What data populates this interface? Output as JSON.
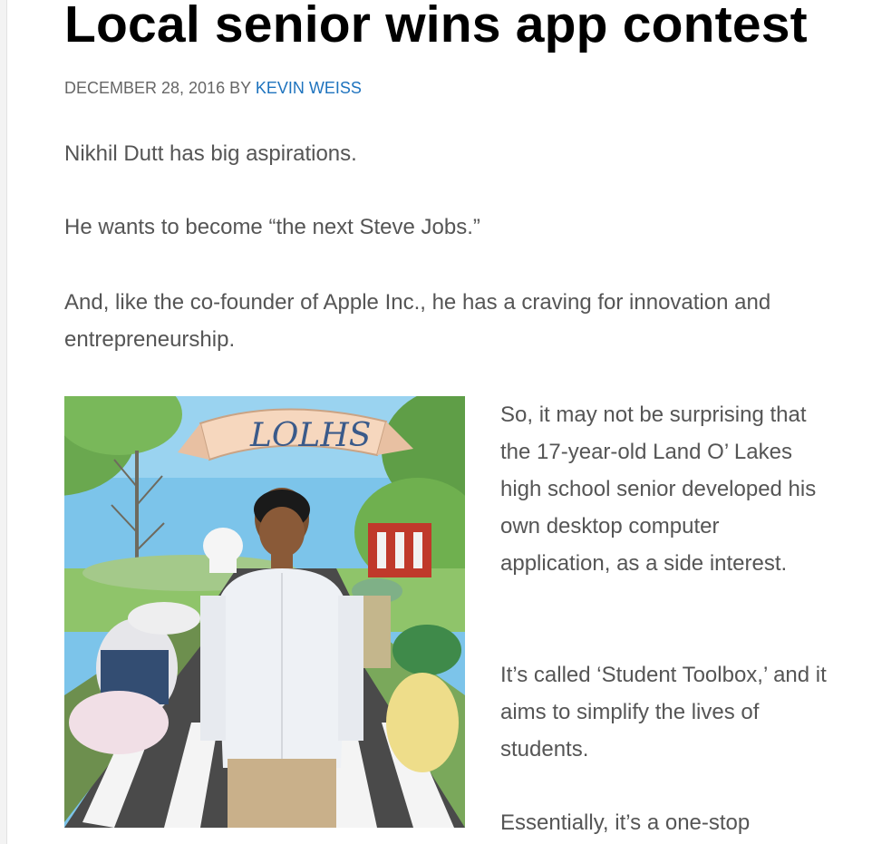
{
  "article": {
    "title": "Local senior wins app contest",
    "date": "DECEMBER 28, 2016",
    "by": "BY",
    "author": "KEVIN WEISS",
    "paragraphs": [
      "Nikhil Dutt has big aspirations.",
      "He wants to become “the next Steve Jobs.”",
      "And, like the co-founder of Apple Inc., he has a craving for innovation and entrepreneurship."
    ],
    "side_paragraphs": [
      "So, it may not be surprising that the 17-year-old Land O’ Lakes high school senior developed his own desktop computer application, as a side interest.",
      "It’s called ‘Student Toolbox,’ and it aims to simplify the lives of students.",
      "Essentially, it’s a one-stop"
    ],
    "photo": {
      "banner_text": "LOLHS",
      "icon": "photo-student-mural"
    }
  },
  "colors": {
    "title": "#000000",
    "body_text": "#555555",
    "link": "#1e73be"
  }
}
